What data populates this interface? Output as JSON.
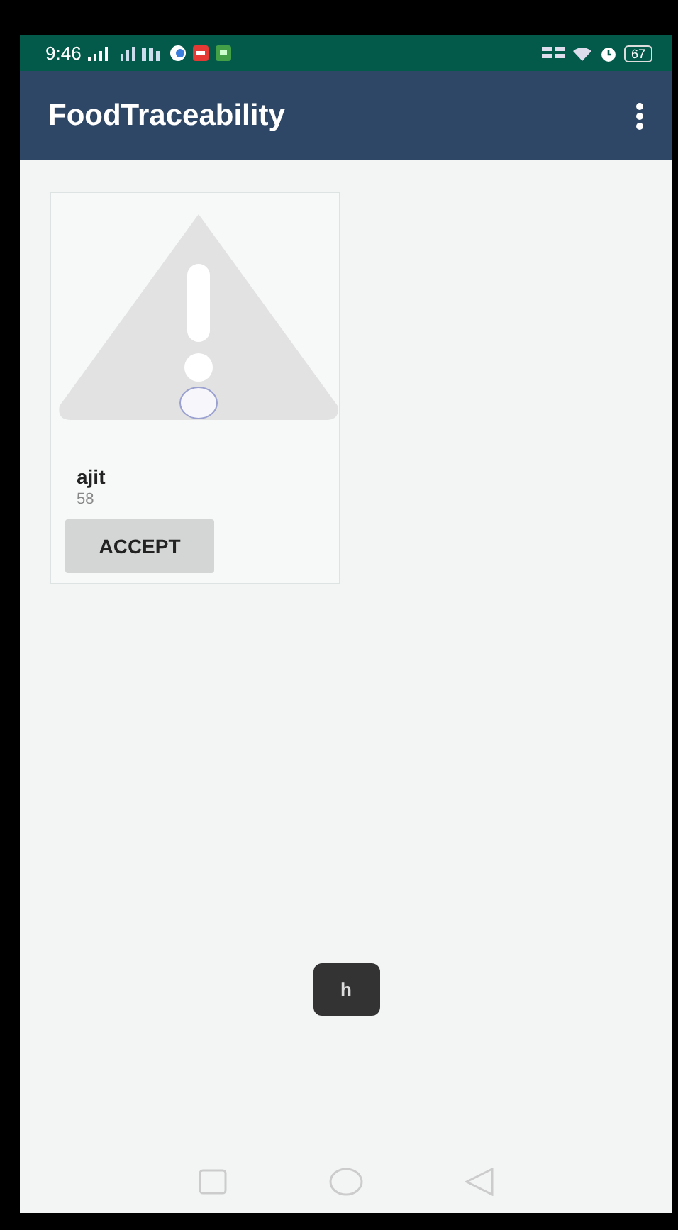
{
  "status_bar": {
    "time": "9:46",
    "battery": "67"
  },
  "app_bar": {
    "title": "FoodTraceability"
  },
  "cards": [
    {
      "name": "ajit",
      "detail": "58",
      "button": "ACCEPT"
    }
  ],
  "toast": {
    "text": "h"
  }
}
